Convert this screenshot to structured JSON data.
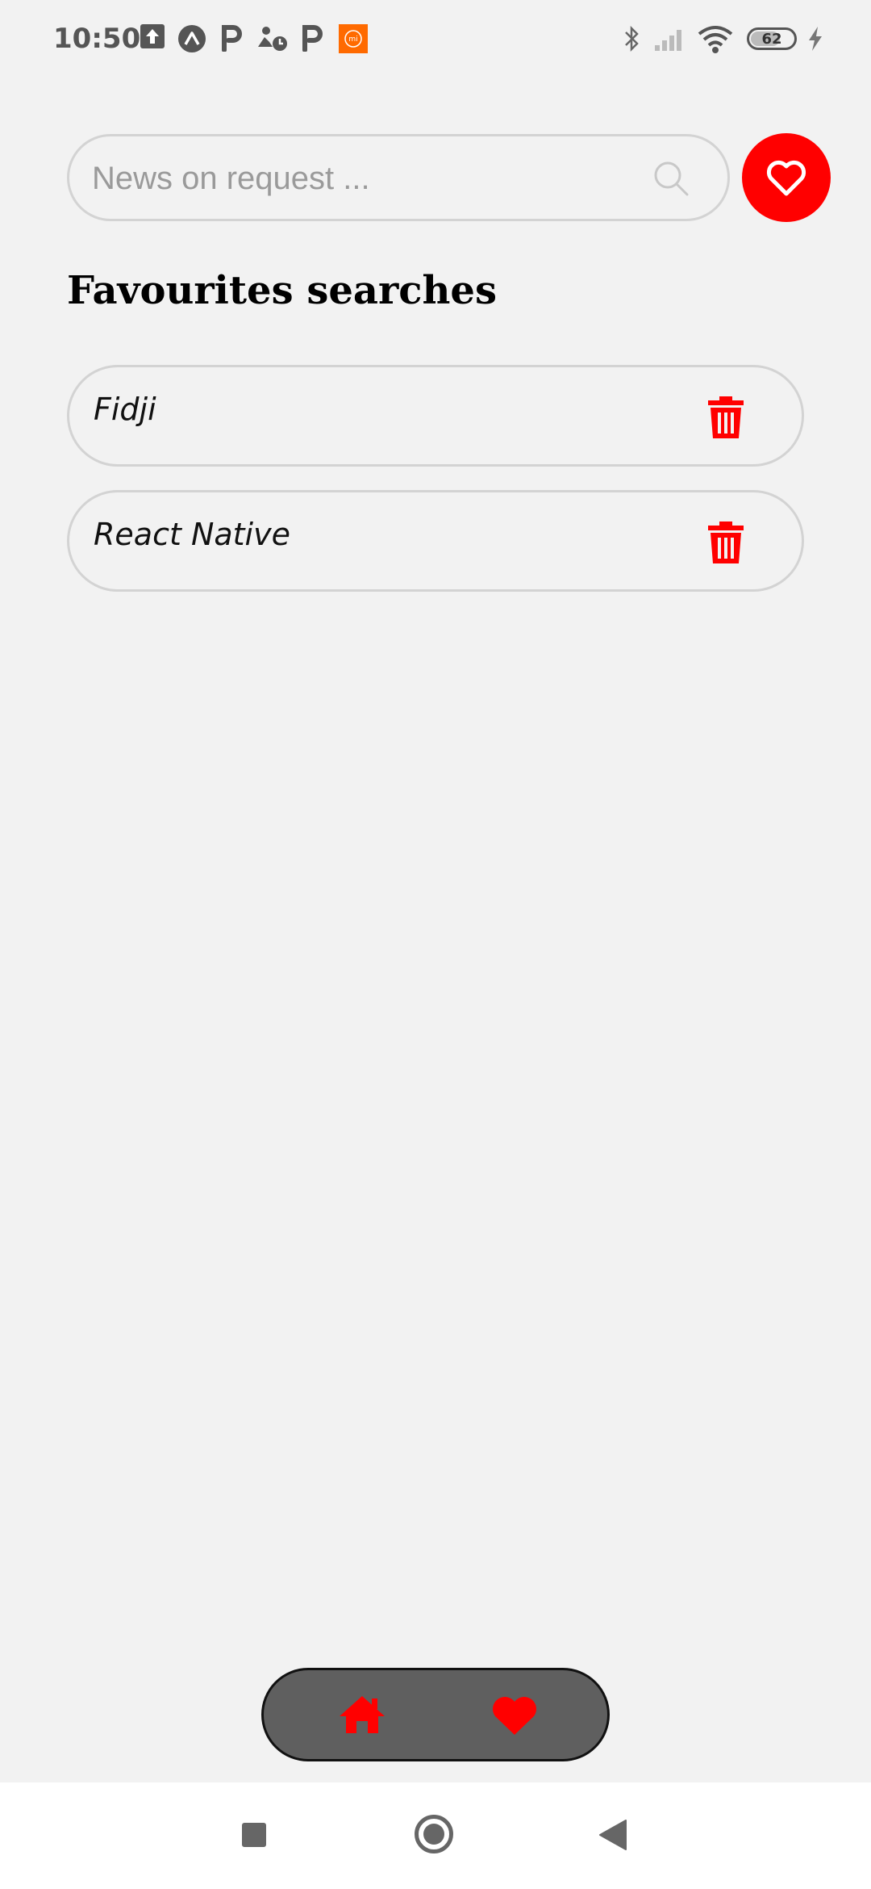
{
  "status_bar": {
    "time": "10:50",
    "battery": "62",
    "notification_icons": [
      "upload-icon",
      "expo-icon",
      "parking-icon",
      "delivery-icon",
      "parking-icon",
      "mi-icon"
    ],
    "system_icons": [
      "bluetooth-icon",
      "signal-icon",
      "wifi-icon",
      "battery-icon",
      "charging-icon"
    ]
  },
  "search": {
    "placeholder": "News on request ..."
  },
  "favourites": {
    "title": "Favourites searches",
    "items": [
      {
        "label": "Fidji"
      },
      {
        "label": "React Native"
      }
    ]
  },
  "tab_bar": {
    "tabs": [
      "home-icon",
      "heart-icon"
    ]
  },
  "colors": {
    "accent": "#ff0000",
    "background": "#f2f2f2",
    "tab_bar": "#5f5f5f",
    "border": "#d3d3d3"
  }
}
